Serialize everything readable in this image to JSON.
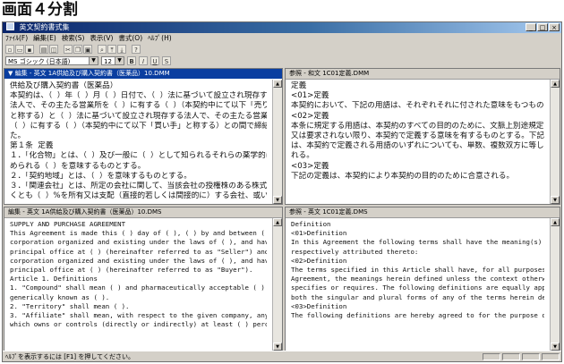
{
  "heading": "画面４分割",
  "window": {
    "title": "英文契約書式集",
    "controls": [
      "_",
      "□",
      "×"
    ]
  },
  "menu": [
    "ﾌｧｲﾙ(F)",
    "編集(E)",
    "検索(S)",
    "表示(V)",
    "書式(O)",
    "ﾍﾙﾌﾟ(H)"
  ],
  "toolbar_icons": [
    "new-icon",
    "open-icon",
    "save-icon",
    "print-icon",
    "preview-icon",
    "cut-icon",
    "copy-icon",
    "paste-icon",
    "find-icon",
    "top-icon",
    "bottom-icon",
    "help-icon"
  ],
  "format": {
    "font": "MS ゴシック (日本語)",
    "size": "12",
    "styles": [
      "B",
      "I",
      "U",
      "S"
    ]
  },
  "panes": {
    "top_left": {
      "header": "▼ 編集 - 英文 1A供給及び購入契約書（医薬品）10.DMM",
      "lines": [
        "供給及び購入契約書（医薬品）",
        "",
        "本契約は、（  ）年（  ）月（  ）日付で、（  ）法に基づいて設立され現存する",
        "法人で、その主たる営業所を（  ）に有する（  ）（本契約中にて以下「売り手」",
        "と称する）と（  ）法に基づいて設立され現存する法人で、その主たる営業所を",
        "（  ）に有する（  ）（本契約中にて以下「買い手」と称する）との間で締結され",
        "た。",
        "",
        "第１条  定義",
        "１．「化合物」とは、（  ）及び一般に（  ）として知られるそれらの薬学的に認",
        "められる（  ）を意味するものとする。",
        "２．「契約地域」とは、（  ）を意味するものとする。",
        "３．「関連会社」とは、所定の会社に関して、当該会社の授権株のある株式の少な",
        "くとも（  ）%を所有又は支配（直接的若しくは間接的に）する会社、或いは授票"
      ]
    },
    "top_right": {
      "header": "参照 - 和文 1C01定義.DMM",
      "lines": [
        "定義",
        "",
        "<01>定義",
        "本契約において、下記の用語は、それぞれそれに付された意味をもつものとする。",
        "",
        "<02>定義",
        "本条に規定する用語は、本契約のすべての目的のために、文脈上別途規定されるか",
        "又は要求されない限り、本契約で定義する意味を有するものとする。下記の定義",
        "は、本契約で定義される用語のいずれについても、単数、複数双方に等しく適用さ",
        "れる。",
        "",
        "<03>定義",
        "下記の定義は、本契約により本契約の目的のために合意される。"
      ]
    },
    "bottom_left": {
      "header": "編集 - 英文 1A供給及び購入契約書（医薬品）10.DMS",
      "lines": [
        "SUPPLY AND PURCHASE AGREEMENT",
        "",
        "This Agreement is made this ( ) day of ( ), ( ) by and between ( ), a",
        "corporation organized and existing under the laws of ( ), and having its",
        "principal office at ( ) (hereinafter referred to as \"Seller\") and ( ), a",
        "corporation organized and existing under the laws of ( ), and having its",
        "principal office at ( ) (hereinafter referred to as \"Buyer\").",
        "",
        "Article 1. Definitions",
        "1. \"Compound\" shall mean ( ) and pharmaceutically acceptable ( ) thereof,",
        "generically known as ( ).",
        "2. \"Territory\" shall mean ( ).",
        "3. \"Affiliate\" shall mean, with respect to the given company, any company",
        "which owns or controls (directly or indirectly) at least ( ) percent of"
      ]
    },
    "bottom_right": {
      "header": "参照 - 英文 1C01定義.DMS",
      "lines": [
        "Definition",
        "",
        "<01>Definition",
        "In this Agreement the following terms shall have the meaning(s)",
        "respectively attributed thereto:",
        "",
        "<02>Definition",
        "The terms specified in this Article shall have, for all purposes of this",
        "Agreement, the meanings herein defined unless the context otherwise",
        "specifies or requires. The following definitions are equally applicable to",
        "both the singular and plural forms of any of the terms herein defined:",
        "",
        "<03>Definition",
        "The following definitions are hereby agreed to for the purpose of this"
      ]
    }
  },
  "status": "ﾍﾙﾌﾟを表示するには [F1] を押してください。"
}
